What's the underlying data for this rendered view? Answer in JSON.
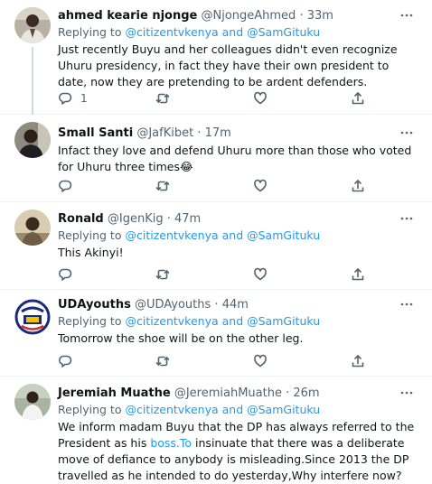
{
  "tweets": [
    {
      "name": "ahmed kearie njonge",
      "handle": "@NjongeAhmed",
      "time": "33m",
      "replying_label": "Replying to",
      "mention1": "@citizentvkenya",
      "and_label": "and",
      "mention2": "@SamGituku",
      "text": "Just recently Buyu and her colleagues didn't even recognize Uhuru presidency, in fact they have their own president to date,  now they are pretending to be ardent defenders.",
      "reply_count": "1",
      "avatar_icon": "man-portrait-avatar"
    },
    {
      "name": "Small Santi",
      "handle": "@JafKibet",
      "time": "17m",
      "text": "Infact they love and defend Uhuru more than those who voted for Uhuru three times",
      "emoji": "😂",
      "avatar_icon": "man-portrait-avatar"
    },
    {
      "name": "Ronald",
      "handle": "@IgenKig",
      "time": "47m",
      "replying_label": "Replying to",
      "mention1": "@citizentvkenya",
      "and_label": "and",
      "mention2": "@SamGituku",
      "text": "This Akinyi!",
      "avatar_icon": "man-portrait-avatar"
    },
    {
      "name": "UDAyouths",
      "handle": "@UDAyouths",
      "time": "44m",
      "replying_label": "Replying to",
      "mention1": "@citizentvkenya",
      "and_label": "and",
      "mention2": "@SamGituku",
      "text": "Tomorrow the shoe will be on the other leg.",
      "avatar_icon": "badge-logo-avatar"
    },
    {
      "name": "Jeremiah Muathe",
      "handle": "@JeremiahMuathe",
      "time": "26m",
      "replying_label": "Replying to",
      "mention1": "@citizentvkenya",
      "and_label": "and",
      "mention2": "@SamGituku",
      "text_before": "We inform madam Buyu that the DP has always referred to the President as his ",
      "link_text": "boss.To",
      "text_after": " insinuate that there was a deliberate move of defiance to anybody is misleading.Since 2013 the DP travelled as he intended to do yesterday,Why interfere now?",
      "avatar_icon": "man-portrait-avatar"
    }
  ],
  "icons": {
    "more": "more-options-icon",
    "reply": "reply-icon",
    "retweet": "retweet-icon",
    "like": "like-icon",
    "share": "share-icon"
  },
  "colors": {
    "link": "#1d9bf0",
    "secondary_text": "#536471",
    "primary_text": "#0f1419",
    "divider": "#eff3f4"
  }
}
